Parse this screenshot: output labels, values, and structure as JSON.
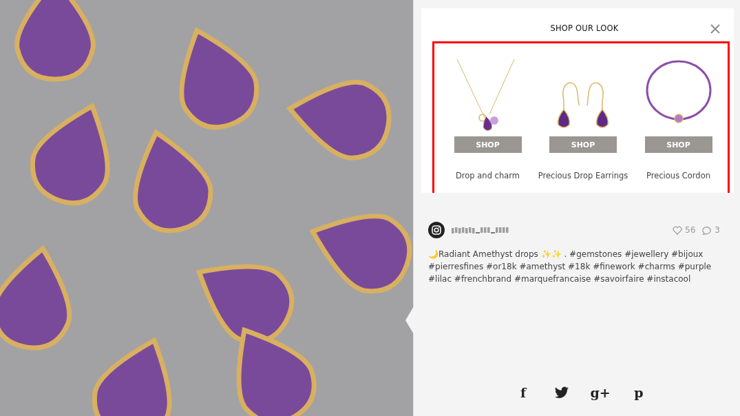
{
  "shop_panel": {
    "title": "SHOP OUR LOOK",
    "products": [
      {
        "kind": "necklace",
        "button": "SHOP",
        "name": "Drop and charm"
      },
      {
        "kind": "earrings",
        "button": "SHOP",
        "name": "Precious Drop Earrings"
      },
      {
        "kind": "bracelet",
        "button": "SHOP",
        "name": "Precious Cordon"
      }
    ]
  },
  "post": {
    "likes": "56",
    "comments": "3",
    "caption": "🌙Radiant Amethyst drops ✨✨ . #gemstones #jewellery #bijoux #pierresfines #or18k #amethyst #18k #finework #charms #purple #lilac #frenchbrand #marquefrancaise #savoirfaire #instacool"
  },
  "share": [
    {
      "kind": "glyph",
      "text": "f"
    },
    {
      "kind": "bird"
    },
    {
      "kind": "glyph",
      "text": "g+"
    },
    {
      "kind": "glyph",
      "text": "p"
    }
  ]
}
